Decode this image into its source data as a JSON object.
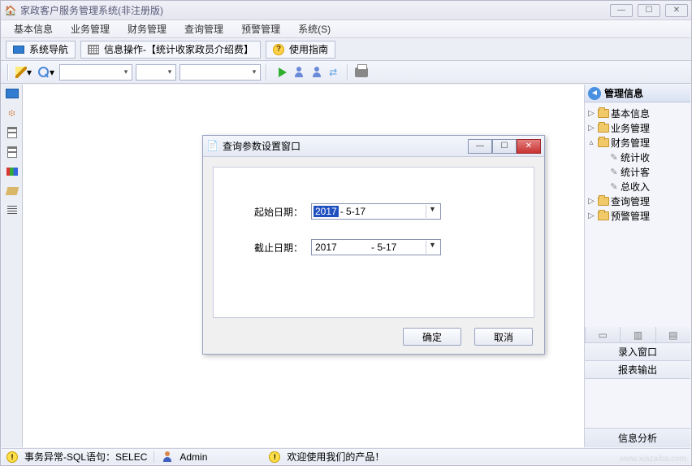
{
  "window": {
    "title": "家政客户服务管理系统(非注册版)"
  },
  "menus": [
    "基本信息",
    "业务管理",
    "财务管理",
    "查询管理",
    "预警管理",
    "系统(S)"
  ],
  "tabs": {
    "nav": "系统导航",
    "info_op": "信息操作-【统计收家政员介绍费】",
    "guide": "使用指南"
  },
  "right": {
    "header": "管理信息",
    "items": {
      "basic": "基本信息",
      "biz": "业务管理",
      "fin": "财务管理",
      "fin_stat_intro": "统计收",
      "fin_stat_cust": "统计客",
      "fin_total": "总收入",
      "query": "查询管理",
      "alert": "预警管理"
    },
    "entry_window": "录入窗口",
    "report_out": "报表输出",
    "info_analysis": "信息分析"
  },
  "dialog": {
    "title": "查询参数设置窗口",
    "start_label": "起始日期：",
    "end_label": "截止日期：",
    "start_year": "2017",
    "start_rest": "- 5-17",
    "end_year": "2017",
    "end_rest": "- 5-17",
    "ok": "确定",
    "cancel": "取消"
  },
  "statusbar": {
    "sql": "事务异常-SQL语句：SELEC",
    "user": "Admin",
    "welcome": "欢迎使用我们的产品！"
  },
  "watermark": "www.xiazaiba.com"
}
